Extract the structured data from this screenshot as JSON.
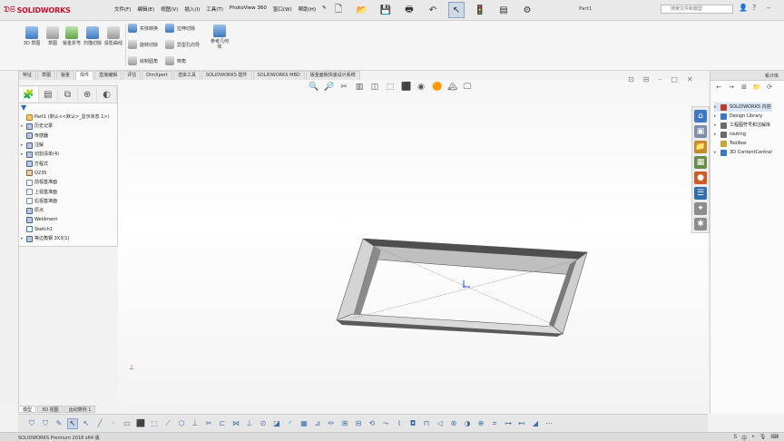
{
  "app": {
    "logo_text": "SOLIDWORKS",
    "document_title": "Part1",
    "search_placeholder": "搜索文件和模型"
  },
  "menus": [
    "文件(F)",
    "编辑(E)",
    "视图(V)",
    "插入(I)",
    "工具(T)",
    "PhotoView 360",
    "窗口(W)",
    "帮助(H)"
  ],
  "ribbon": {
    "buttons": [
      "3D 草图",
      "草图",
      "钣金折弯",
      "扫描切除",
      "投影曲线",
      "参考几何体"
    ],
    "small": [
      "实体转换",
      "拉伸切除",
      "异型孔向导",
      "旋转切除",
      "绘制圆角",
      "倒角"
    ]
  },
  "command_tabs": [
    "特征",
    "草图",
    "钣金",
    "焊件",
    "直接编辑",
    "评估",
    "DimXpert",
    "渲染工具",
    "SOLIDWORKS 插件",
    "SOLIDWORKS MBD",
    "钣金面板快速设计系统"
  ],
  "active_command_tab": 3,
  "feature_tree": [
    {
      "label": "Part1 (默认<<默认>_显示状态 1>)",
      "icon": "part",
      "exp": ""
    },
    {
      "label": "历史记录",
      "icon": "feat",
      "exp": "▸"
    },
    {
      "label": "传感器",
      "icon": "feat",
      "exp": ""
    },
    {
      "label": "注解",
      "icon": "feat",
      "exp": "▸"
    },
    {
      "label": "切割清单(4)",
      "icon": "feat",
      "exp": "▸"
    },
    {
      "label": "方程式",
      "icon": "feat",
      "exp": ""
    },
    {
      "label": "Q235",
      "icon": "mat",
      "exp": ""
    },
    {
      "label": "前视基准面",
      "icon": "plane",
      "exp": ""
    },
    {
      "label": "上视基准面",
      "icon": "plane",
      "exp": ""
    },
    {
      "label": "右视基准面",
      "icon": "plane",
      "exp": ""
    },
    {
      "label": "原点",
      "icon": "feat",
      "exp": ""
    },
    {
      "label": "Weldment",
      "icon": "feat",
      "exp": ""
    },
    {
      "label": "Sketch1",
      "icon": "sk",
      "exp": ""
    },
    {
      "label": "等边角钢 3X3(1)",
      "icon": "feat",
      "exp": "▸"
    }
  ],
  "bottom_tabs": [
    "模型",
    "3D 视图",
    "运动算例 1"
  ],
  "status_text": "SOLIDWORKS Premium 2018 x64 版",
  "taskpane": {
    "title": "设计库",
    "items": [
      {
        "label": "SOLIDWORKS 内容",
        "color": "#c0392b",
        "exp": "▸"
      },
      {
        "label": "Design Library",
        "color": "#3b79c2",
        "exp": "▸"
      },
      {
        "label": "工程图符号和注解库",
        "color": "#6a6a6a",
        "exp": "▸"
      },
      {
        "label": "routing",
        "color": "#6a6a6a",
        "exp": "▸"
      },
      {
        "label": "Toolbox",
        "color": "#c8a63a",
        "exp": ""
      },
      {
        "label": "3D ContentCentral",
        "color": "#3b79c2",
        "exp": "▸"
      }
    ]
  },
  "colors": {
    "accent": "#c8102e",
    "frame_face": "#d9d9d9",
    "frame_dark": "#5d5d5d"
  }
}
